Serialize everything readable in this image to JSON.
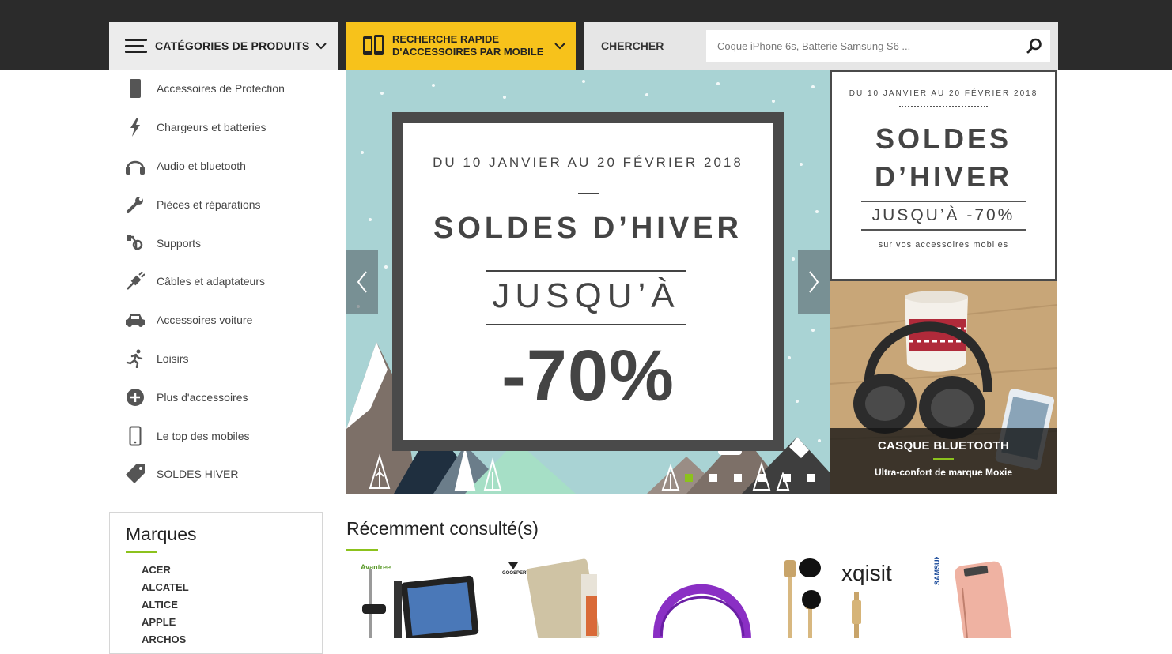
{
  "header": {
    "categories_label": "CATÉGORIES DE PRODUITS",
    "quick_search_label": "RECHERCHE RAPIDE D'ACCESSOIRES PAR MOBILE",
    "search_label": "CHERCHER",
    "search_placeholder": "Coque iPhone 6s, Batterie Samsung S6 ..."
  },
  "sidebar": {
    "items": [
      {
        "label": "Accessoires de Protection",
        "icon": "phone-case-icon"
      },
      {
        "label": "Chargeurs et batteries",
        "icon": "lightning-icon"
      },
      {
        "label": "Audio et bluetooth",
        "icon": "headphones-icon"
      },
      {
        "label": "Pièces et réparations",
        "icon": "wrench-icon"
      },
      {
        "label": "Supports",
        "icon": "support-mount-icon"
      },
      {
        "label": "Câbles et adaptateurs",
        "icon": "cable-plug-icon"
      },
      {
        "label": "Accessoires voiture",
        "icon": "car-icon"
      },
      {
        "label": "Loisirs",
        "icon": "runner-icon"
      },
      {
        "label": "Plus d'accessoires",
        "icon": "plus-circle-icon"
      },
      {
        "label": "Le top des mobiles",
        "icon": "smartphone-icon"
      },
      {
        "label": "SOLDES HIVER",
        "icon": "tag-icon"
      }
    ]
  },
  "hero": {
    "dates": "DU 10 JANVIER AU 20 FÉVRIER 2018",
    "title": "SOLDES D’HIVER",
    "upto": "JUSQU’À",
    "percent": "-70%",
    "slide_count": 6,
    "active_slide": 1
  },
  "side_banner": {
    "dates": "DU 10 JANVIER AU 20 FÉVRIER 2018",
    "title_line1": "SOLDES",
    "title_line2": "D’HIVER",
    "upto": "JUSQU’À -70%",
    "subtitle": "sur vos accessoires mobiles"
  },
  "photo_banner": {
    "title": "CASQUE BLUETOOTH",
    "subtitle": "Ultra-confort de marque Moxie"
  },
  "brands": {
    "title": "Marques",
    "items": [
      "ACER",
      "ALCATEL",
      "ALTICE",
      "APPLE",
      "ARCHOS"
    ]
  },
  "recent": {
    "title": "Récemment consulté(s)",
    "products": [
      {
        "brand_mark": "Avantree",
        "icon": "tablet-mount-icon"
      },
      {
        "brand_mark": "GOOSPERY",
        "icon": "folio-case-icon"
      },
      {
        "brand_mark": "",
        "icon": "purple-headphones-icon"
      },
      {
        "brand_mark": "xqisit",
        "icon": "earphones-icon"
      },
      {
        "brand_mark": "SAMSUNG",
        "icon": "powerbank-icon"
      }
    ]
  },
  "colors": {
    "topbar": "#2b2b2b",
    "accent_yellow": "#f7c21b",
    "accent_green": "#8cc21d",
    "hero_bg": "#a9d3d4",
    "promo_dark": "#4a4a4a"
  }
}
